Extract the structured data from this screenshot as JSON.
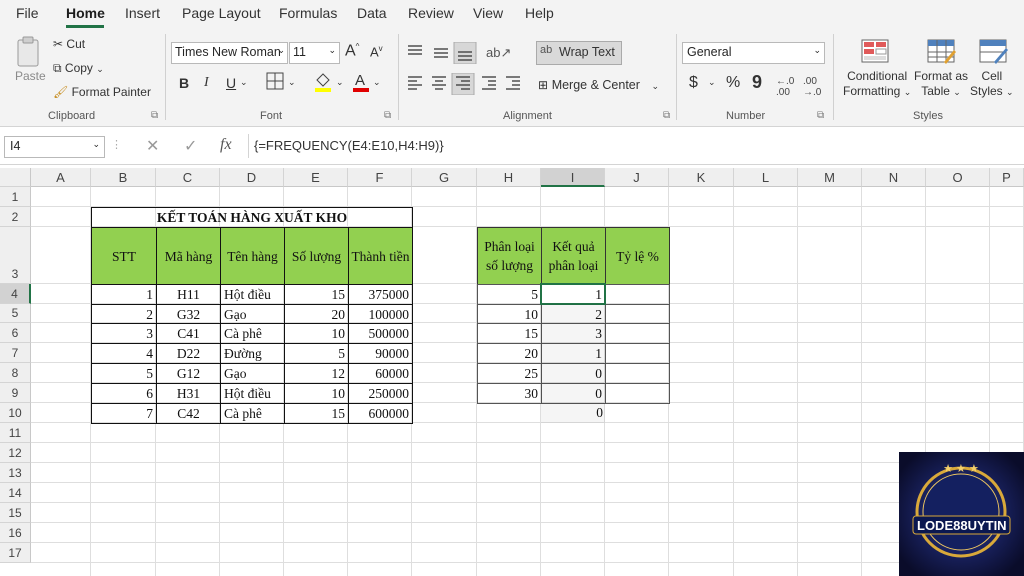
{
  "menu": [
    "File",
    "Home",
    "Insert",
    "Page Layout",
    "Formulas",
    "Data",
    "Review",
    "View",
    "Help"
  ],
  "clipboard": {
    "paste": "Paste",
    "cut": "Cut",
    "copy": "Copy",
    "format_painter": "Format Painter",
    "label": "Clipboard"
  },
  "font": {
    "name": "Times New Roman",
    "size": "11",
    "label": "Font",
    "bold": "B",
    "italic": "I",
    "underline": "U",
    "grow": "A",
    "shrink": "A"
  },
  "alignment": {
    "wrap_text": "Wrap Text",
    "merge_center": "Merge & Center",
    "label": "Alignment"
  },
  "number": {
    "format": "General",
    "currency": "$",
    "percent": "%",
    "comma": "9",
    "label": "Number"
  },
  "styles": {
    "conditional": "Conditional",
    "formatting": "Formatting",
    "format_as": "Format as",
    "table": "Table",
    "cell": "Cell",
    "styles_btn": "Styles",
    "label": "Styles"
  },
  "formula_bar": {
    "name_box": "I4",
    "fx": "fx",
    "formula": "{=FREQUENCY(E4:E10,H4:H9)}"
  },
  "columns": [
    "A",
    "B",
    "C",
    "D",
    "E",
    "F",
    "G",
    "H",
    "I",
    "J",
    "K",
    "L",
    "M",
    "N",
    "O",
    "P"
  ],
  "rows": [
    "1",
    "2",
    "3",
    "4",
    "5",
    "6",
    "7",
    "8",
    "9",
    "10",
    "11",
    "12",
    "13",
    "14",
    "15",
    "16",
    "17"
  ],
  "sheet": {
    "title": "KẾT TOÁN HÀNG XUẤT KHO",
    "headers": [
      "STT",
      "Mã hàng",
      "Tên hàng",
      "Số lượng",
      "Thành tiền"
    ],
    "data": [
      [
        "1",
        "H11",
        "Hột điều",
        "15",
        "375000"
      ],
      [
        "2",
        "G32",
        "Gạo",
        "20",
        "100000"
      ],
      [
        "3",
        "C41",
        "Cà phê",
        "10",
        "500000"
      ],
      [
        "4",
        "D22",
        "Đường",
        "5",
        "90000"
      ],
      [
        "5",
        "G12",
        "Gạo",
        "12",
        "60000"
      ],
      [
        "6",
        "H31",
        "Hột điều",
        "10",
        "250000"
      ],
      [
        "7",
        "C42",
        "Cà phê",
        "15",
        "600000"
      ]
    ],
    "freq_headers": [
      "Phân loại số lượng",
      "Kết quả phân loại",
      "Tỷ lệ %"
    ],
    "freq_bins": [
      "5",
      "10",
      "15",
      "20",
      "25",
      "30"
    ],
    "freq_results": [
      "1",
      "2",
      "3",
      "1",
      "0",
      "0",
      "0"
    ]
  },
  "logo": {
    "text": "LODE88UYTIN"
  },
  "colors": {
    "header_green": "#92d050",
    "accent": "#217346"
  }
}
